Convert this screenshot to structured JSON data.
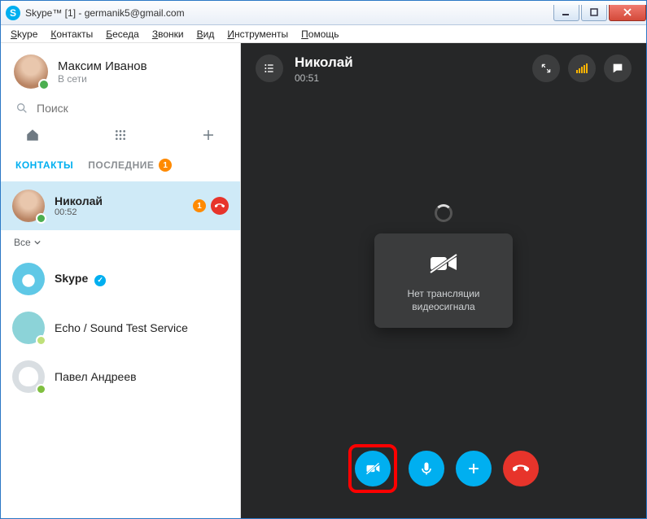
{
  "window": {
    "title": "Skype™ [1] - germanik5@gmail.com",
    "app_glyph": "S"
  },
  "menu": [
    "Skype",
    "Контакты",
    "Беседа",
    "Звонки",
    "Вид",
    "Инструменты",
    "Помощь"
  ],
  "profile": {
    "name": "Максим Иванов",
    "status": "В сети"
  },
  "search": {
    "placeholder": "Поиск"
  },
  "tabs": {
    "contacts": "КОНТАКТЫ",
    "recent": "ПОСЛЕДНИЕ",
    "recent_badge": "1"
  },
  "active_contact": {
    "name": "Николай",
    "duration": "00:52",
    "badge": "1"
  },
  "filter": {
    "label": "Все"
  },
  "contacts": [
    {
      "name": "Skype",
      "verified": true
    },
    {
      "name": "Echo / Sound Test Service"
    },
    {
      "name": "Павел Андреев"
    }
  ],
  "call": {
    "name": "Николай",
    "duration": "00:51",
    "no_video_line1": "Нет трансляции",
    "no_video_line2": "видеосигнала"
  }
}
